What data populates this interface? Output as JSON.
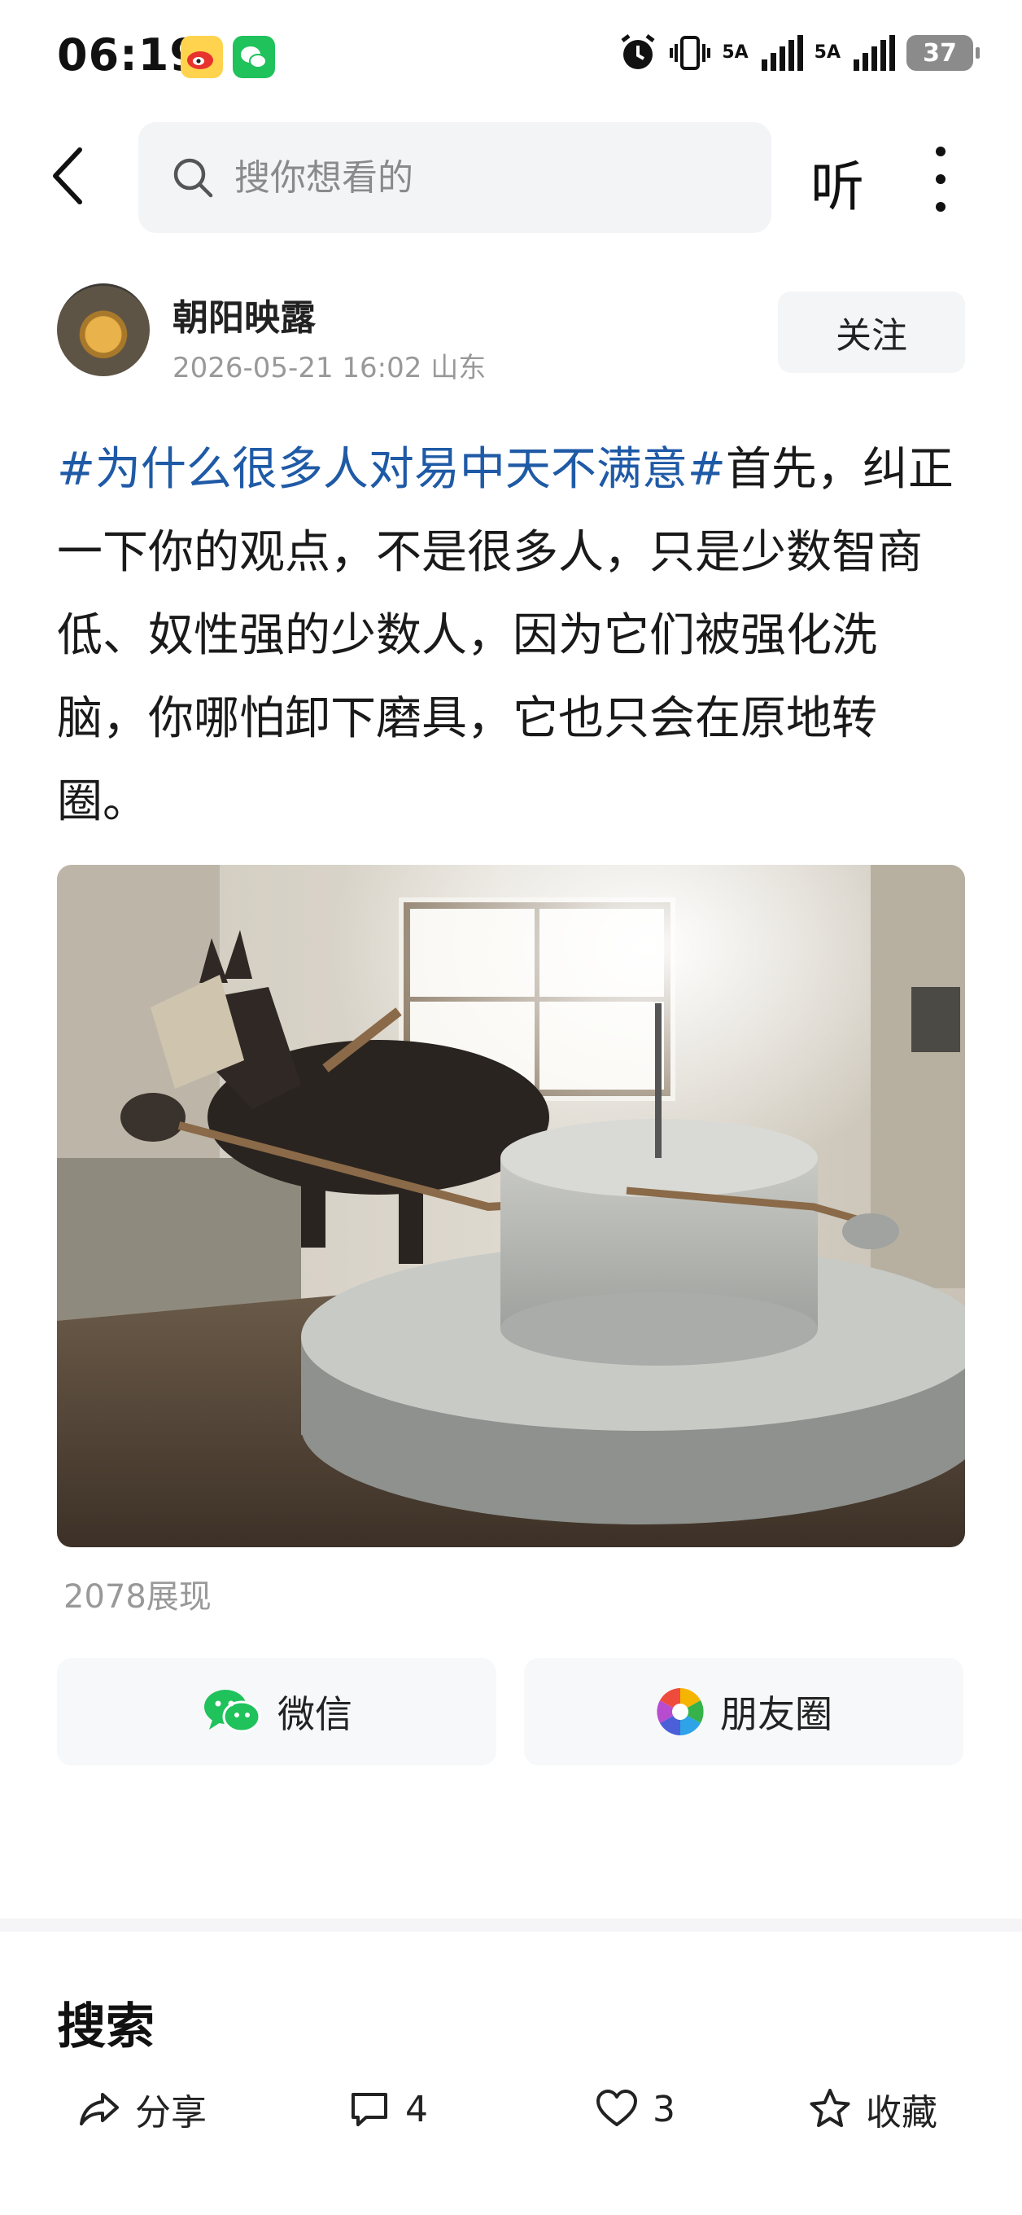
{
  "status_bar": {
    "time": "06:19",
    "net1": "5A",
    "net2": "5A",
    "battery": "37",
    "icons": [
      "weibo-app-icon",
      "wechat-app-icon",
      "alarm-icon",
      "vibrate-icon",
      "signal-icon",
      "signal-icon",
      "battery-icon"
    ]
  },
  "nav": {
    "search_placeholder": "搜你想看的",
    "listen_label": "听"
  },
  "author": {
    "name": "朝阳映露",
    "meta": "2026-05-21 16:02 山东",
    "follow_label": "关注"
  },
  "post": {
    "hashtag": "#为什么很多人对易中天不满意#",
    "body": "首先，纠正一下你的观点，不是很多人，只是少数智商低、奴性强的少数人，因为它们被强化洗脑，你哪怕卸下磨具，它也只会在原地转圈。",
    "views": "2078展现"
  },
  "share": {
    "wechat_label": "微信",
    "moments_label": "朋友圈"
  },
  "section": {
    "search_heading": "搜索"
  },
  "actions": {
    "share_label": "分享",
    "comment_count": "4",
    "like_count": "3",
    "favorite_label": "收藏"
  },
  "colors": {
    "hashtag": "#1f5aa6",
    "wechat_green": "#1fc25b",
    "muted_text": "#999999"
  }
}
